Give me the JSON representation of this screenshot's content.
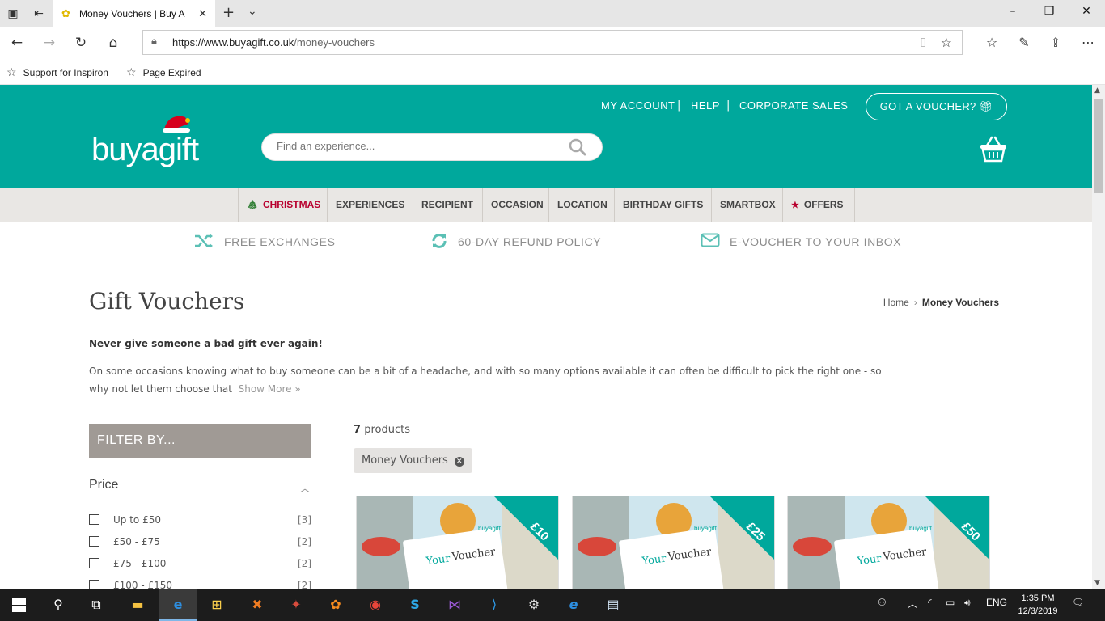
{
  "browser": {
    "tab_title": "Money Vouchers | Buy A",
    "url_host": "https://www.buyagift.co.uk",
    "url_path": "/money-vouchers",
    "favorites": [
      {
        "label": "Support for Inspiron"
      },
      {
        "label": "Page Expired"
      }
    ]
  },
  "header": {
    "logo_text": "buyagift",
    "top_links": [
      "MY ACCOUNT",
      "HELP",
      "CORPORATE SALES"
    ],
    "voucher_button": "GOT A VOUCHER?",
    "search_placeholder": "Find an experience..."
  },
  "category_nav": [
    {
      "label": "CHRISTMAS",
      "icon": "tree-icon"
    },
    {
      "label": "EXPERIENCES"
    },
    {
      "label": "RECIPIENT"
    },
    {
      "label": "OCCASION"
    },
    {
      "label": "LOCATION"
    },
    {
      "label": "BIRTHDAY GIFTS"
    },
    {
      "label": "SMARTBOX"
    },
    {
      "label": "OFFERS",
      "icon": "star-icon"
    }
  ],
  "usps": [
    {
      "label": "FREE EXCHANGES",
      "icon": "shuffle-icon"
    },
    {
      "label": "60-DAY REFUND POLICY",
      "icon": "refresh-icon"
    },
    {
      "label": "E-VOUCHER TO YOUR INBOX",
      "icon": "envelope-icon"
    }
  ],
  "page": {
    "title": "Gift Vouchers",
    "breadcrumb_home": "Home",
    "breadcrumb_current": "Money Vouchers",
    "intro_bold": "Never give someone a bad gift ever again!",
    "intro_text": "On some occasions knowing what to buy someone can be a bit of a headache, and with so many options available it can often be difficult to pick the right one - so why not let them choose that",
    "show_more": "Show More »"
  },
  "filters": {
    "heading": "FILTER BY...",
    "price_heading": "Price",
    "price_options": [
      {
        "label": "Up to £50",
        "count": "[3]"
      },
      {
        "label": "£50 - £75",
        "count": "[2]"
      },
      {
        "label": "£75 - £100",
        "count": "[2]"
      },
      {
        "label": "£100 - £150",
        "count": "[2]"
      }
    ]
  },
  "results": {
    "count": "7",
    "count_suffix": "products",
    "active_chip": "Money Vouchers",
    "cards": [
      {
        "badge": "£10",
        "card_brand": "buyagift",
        "card_text_1": "Your",
        "card_text_2": "Voucher"
      },
      {
        "badge": "£25",
        "card_brand": "buyagift",
        "card_text_1": "Your",
        "card_text_2": "Voucher"
      },
      {
        "badge": "£50",
        "card_brand": "buyagift",
        "card_text_1": "Your",
        "card_text_2": "Voucher"
      }
    ]
  },
  "taskbar": {
    "time": "1:35 PM",
    "date": "12/3/2019",
    "lang": "ENG"
  },
  "colors": {
    "brand_teal": "#00a89c",
    "christmas_red": "#b8002e",
    "filter_grey": "#a09a95"
  }
}
